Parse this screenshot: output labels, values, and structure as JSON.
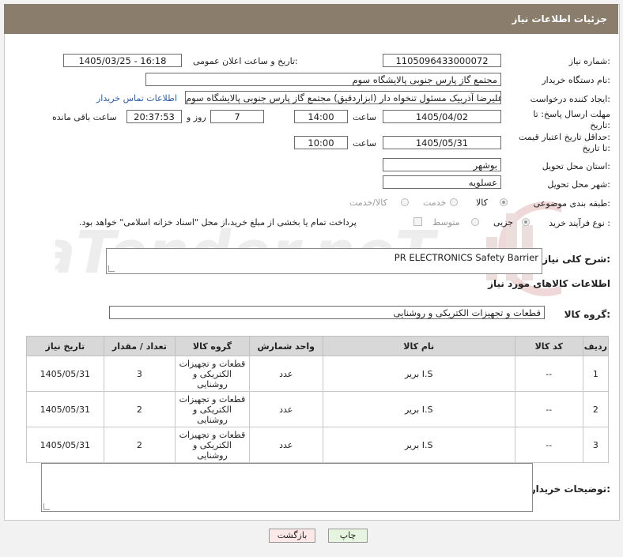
{
  "header": {
    "title": "جزئیات اطلاعات نیاز"
  },
  "form": {
    "need_number_label": "شماره نیاز:",
    "need_number": "1105096433000072",
    "announce_label": "تاریخ و ساعت اعلان عمومی:",
    "announce_value": "1405/03/25 - 16:18",
    "buyer_label": "نام دستگاه خریدار:",
    "buyer_value": "مجتمع گاز پارس جنوبی  پالایشگاه سوم",
    "creator_label": "ایجاد کننده درخواست:",
    "creator_value": "علیرضا آذربیک مسئول تنخواه دار  (ابزاردقیق) مجتمع گاز پارس جنوبی  پالایشگاه سوم",
    "contact_link": "اطلاعات تماس خریدار",
    "deadline_label_1": "مهلت ارسال پاسخ: تا",
    "deadline_label_2": "تاریخ:",
    "deadline_date": "1405/04/02",
    "time_label": "ساعت",
    "deadline_time": "14:00",
    "days_value": "7",
    "days_label": "روز و",
    "remaining_time": "20:37:53",
    "remaining_label": "ساعت باقی مانده",
    "price_label_1": "حداقل تاریخ اعتبار قیمت:",
    "price_label_2": "تا تاریخ:",
    "price_date": "1405/05/31",
    "price_time": "10:00",
    "province_label": "استان محل تحویل:",
    "province_value": "بوشهر",
    "city_label": "شهر محل تحویل:",
    "city_value": "عسلویه",
    "category_label": "طبقه بندی موضوعی:",
    "category_options": [
      "کالا",
      "خدمت",
      "کالا/خدمت"
    ],
    "process_label": "نوع فرآیند خرید :",
    "process_options": [
      "جزیی",
      "متوسط"
    ],
    "payment_note": "پرداخت تمام یا بخشی از مبلغ خرید،از محل \"اسناد خزانه اسلامی\" خواهد بود."
  },
  "description": {
    "label": "شرح کلی نیاز:",
    "value": "PR ELECTRONICS Safety Barrier"
  },
  "goods": {
    "title": "اطلاعات کالاهای مورد نیاز",
    "group_label": "گروه کالا:",
    "group_value": "قطعات و تجهیزات الکتریکی و روشنایی"
  },
  "table": {
    "headers": [
      "ردیف",
      "کد کالا",
      "نام کالا",
      "واحد شمارش",
      "گروه کالا",
      "تعداد / مقدار",
      "تاریخ نیاز"
    ],
    "rows": [
      {
        "row": "1",
        "code": "--",
        "name": "I.S بریر",
        "unit": "عدد",
        "group": "قطعات و تجهیزات الکتریکی و روشنایی",
        "qty": "3",
        "date": "1405/05/31"
      },
      {
        "row": "2",
        "code": "--",
        "name": "I.S بریر",
        "unit": "عدد",
        "group": "قطعات و تجهیزات الکتریکی و روشنایی",
        "qty": "2",
        "date": "1405/05/31"
      },
      {
        "row": "3",
        "code": "--",
        "name": "I.S بریر",
        "unit": "عدد",
        "group": "قطعات و تجهیزات الکتریکی و روشنایی",
        "qty": "2",
        "date": "1405/05/31"
      }
    ]
  },
  "buyer_notes": {
    "label": "توضیحات خریدار:",
    "value": ""
  },
  "buttons": {
    "back": "بازگشت",
    "print": "چاپ"
  },
  "colors": {
    "header_bg": "#8b7d6b",
    "back_bg": "#fde8e8",
    "print_bg": "#e6f5e0"
  }
}
